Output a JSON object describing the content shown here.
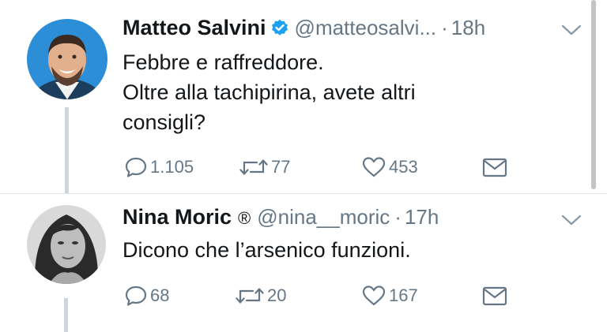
{
  "tweets": [
    {
      "name": "Matteo Salvini",
      "handle": "@matteosalvi...",
      "time": "18h",
      "text_lines": [
        "Febbre e raffreddore.",
        "Oltre alla tachipirina, avete altri",
        "consigli?"
      ],
      "replies": "1.105",
      "retweets": "77",
      "likes": "453",
      "verified": true
    },
    {
      "name": "Nina Moric",
      "badge": "®",
      "handle": "@nina__moric",
      "time": "17h",
      "text_lines": [
        "Dicono che l’arsenico funzioni."
      ],
      "replies": "68",
      "retweets": "20",
      "likes": "167"
    }
  ],
  "separator": "·",
  "colors": {
    "verified_blue": "#1da1f2",
    "icon_gray": "#657786",
    "thread_line": "#ccd6dd"
  }
}
